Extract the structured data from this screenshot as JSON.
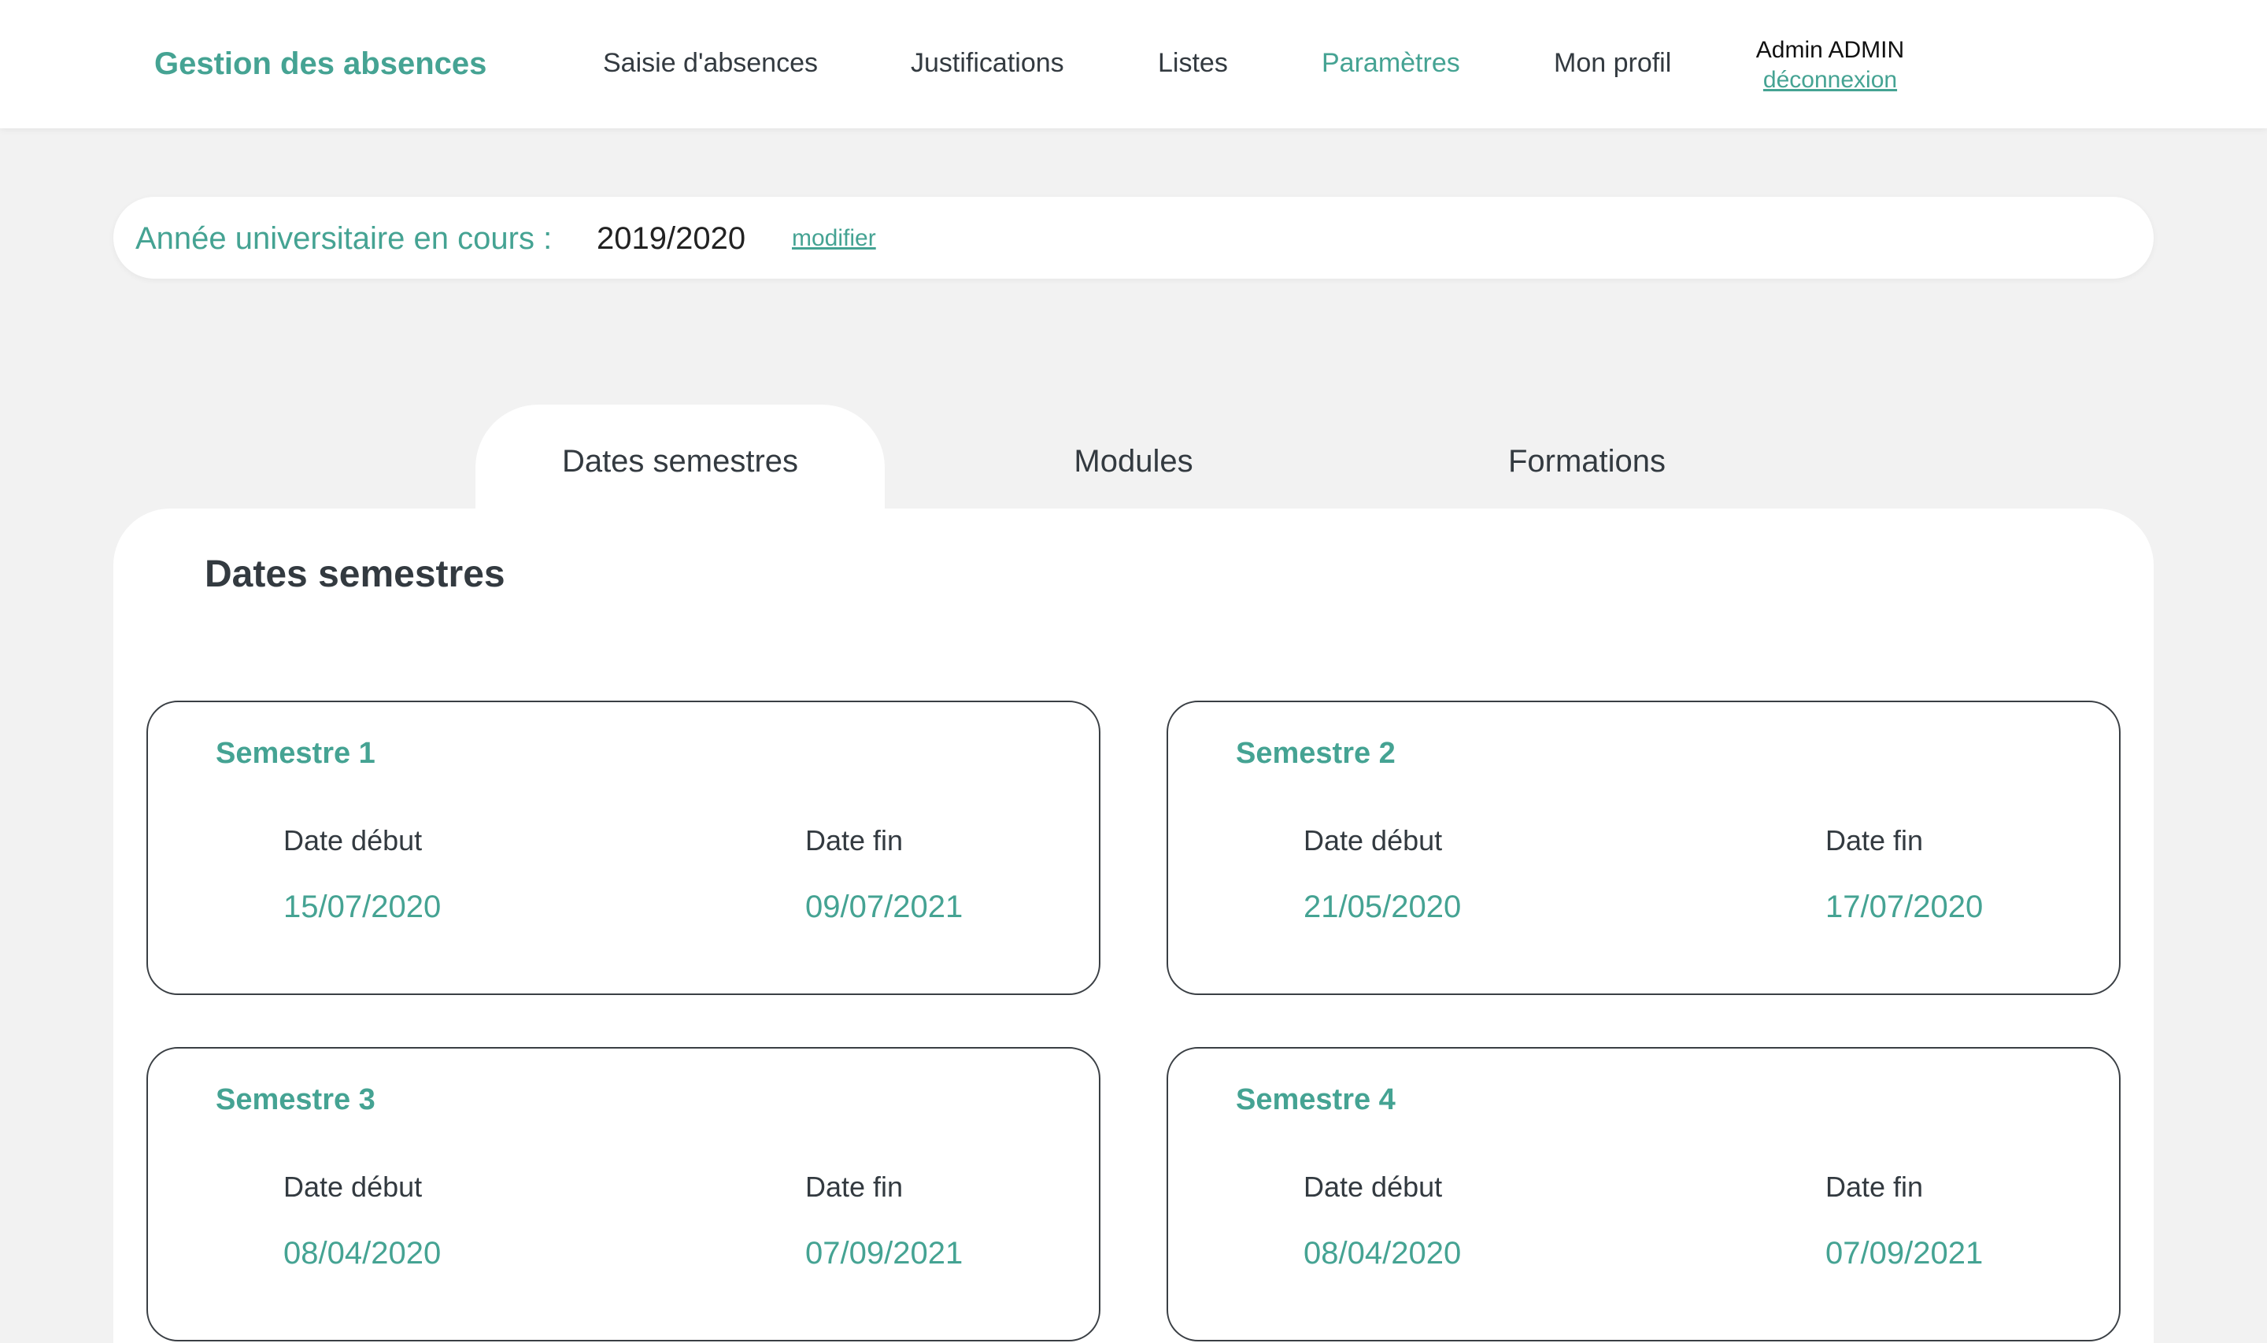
{
  "header": {
    "brand": "Gestion des absences",
    "nav": [
      {
        "label": "Saisie d'absences",
        "active": false
      },
      {
        "label": "Justifications",
        "active": false
      },
      {
        "label": "Listes",
        "active": false
      },
      {
        "label": "Paramètres",
        "active": true
      },
      {
        "label": "Mon profil",
        "active": false
      }
    ],
    "user_name": "Admin ADMIN",
    "logout_label": "déconnexion"
  },
  "year_bar": {
    "label": "Année universitaire en cours :",
    "value": "2019/2020",
    "edit_label": "modifier"
  },
  "tabs": [
    {
      "label": "Dates semestres",
      "active": true
    },
    {
      "label": "Modules",
      "active": false
    },
    {
      "label": "Formations",
      "active": false
    }
  ],
  "panel": {
    "title": "Dates semestres",
    "start_label": "Date début",
    "end_label": "Date fin",
    "semesters": [
      {
        "title": "Semestre 1",
        "start": "15/07/2020",
        "end": "09/07/2021"
      },
      {
        "title": "Semestre 2",
        "start": "21/05/2020",
        "end": "17/07/2020"
      },
      {
        "title": "Semestre 3",
        "start": "08/04/2020",
        "end": "07/09/2021"
      },
      {
        "title": "Semestre 4",
        "start": "08/04/2020",
        "end": "07/09/2021"
      }
    ]
  },
  "colors": {
    "accent": "#45a393",
    "text": "#333a40",
    "background": "#f2f2f2"
  }
}
